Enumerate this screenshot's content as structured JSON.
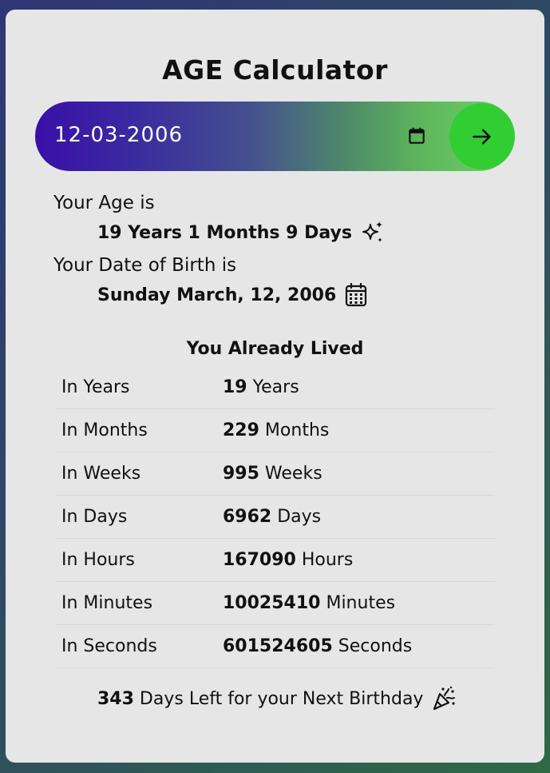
{
  "title": "AGE Calculator",
  "date_input": {
    "value": "12-03-2006"
  },
  "age": {
    "label": "Your Age is",
    "value": "19 Years 1 Months 9 Days"
  },
  "dob": {
    "label": "Your Date of Birth is",
    "value": "Sunday March, 12, 2006"
  },
  "lived": {
    "title": "You Already Lived",
    "rows": [
      {
        "label": "In Years",
        "number": "19",
        "unit": " Years"
      },
      {
        "label": "In Months",
        "number": "229",
        "unit": " Months"
      },
      {
        "label": "In Weeks",
        "number": "995",
        "unit": " Weeks"
      },
      {
        "label": "In Days",
        "number": "6962",
        "unit": " Days"
      },
      {
        "label": "In Hours",
        "number": "167090",
        "unit": " Hours"
      },
      {
        "label": "In Minutes",
        "number": "10025410",
        "unit": " Minutes"
      },
      {
        "label": "In Seconds",
        "number": "601524605",
        "unit": " Seconds"
      }
    ]
  },
  "next_birthday": {
    "days": "343",
    "text": " Days Left for your Next Birthday"
  },
  "colors": {
    "accent_green": "#32cd32",
    "gradient_start": "#3a0fa8",
    "card_background": "#e6e6e6"
  },
  "icons": {
    "calendar_picker": "calendar-icon",
    "submit": "arrow-right-icon",
    "age": "sparkles-icon",
    "dob": "calendar-grid-icon",
    "birthday": "party-popper-icon"
  }
}
